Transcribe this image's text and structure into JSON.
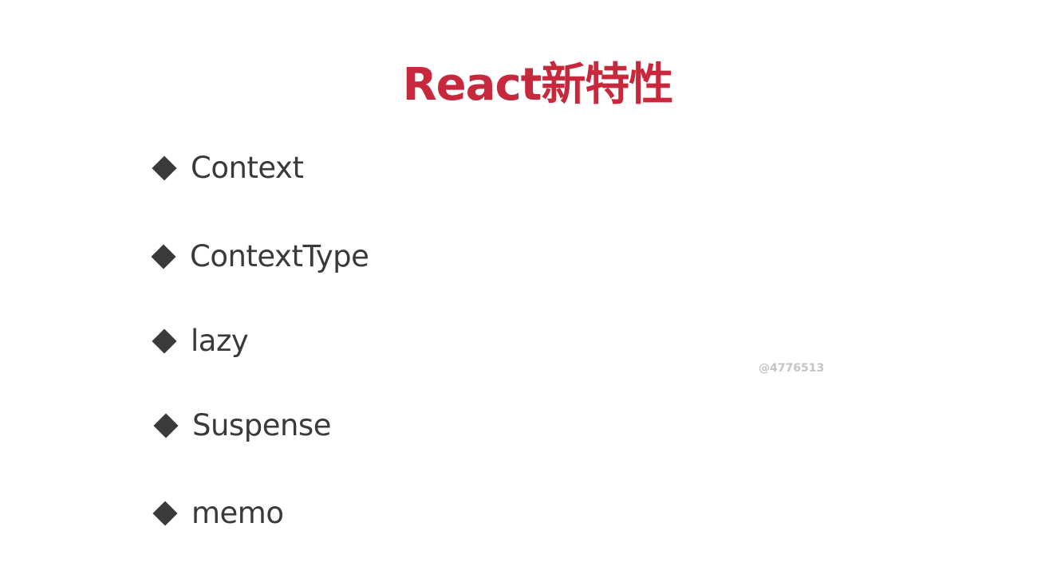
{
  "slide": {
    "title": "React新特性",
    "title_color": "#c8283c",
    "text_color": "#3a3a3c",
    "bullet_icon": "diamond-icon",
    "bullets": [
      {
        "label": "Context"
      },
      {
        "label": "ContextType"
      },
      {
        "label": "lazy"
      },
      {
        "label": "Suspense"
      },
      {
        "label": "memo"
      }
    ],
    "watermark": "@4776513"
  }
}
